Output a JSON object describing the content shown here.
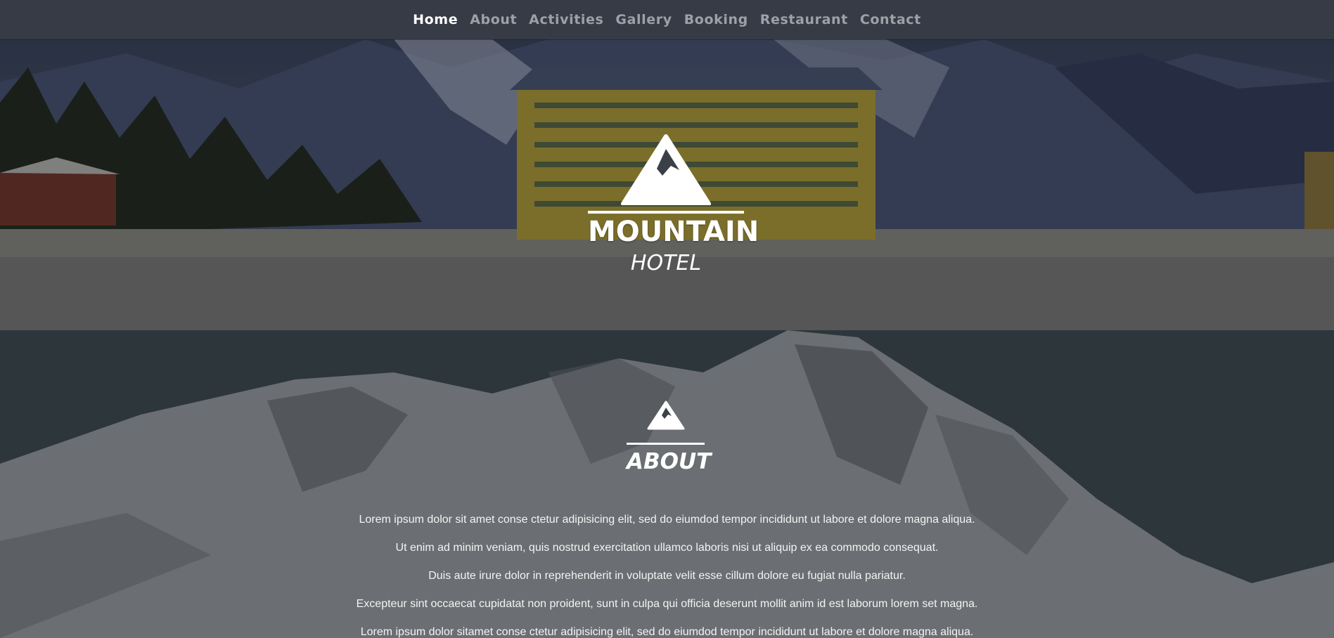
{
  "nav": {
    "items": [
      {
        "label": "Home",
        "active": true
      },
      {
        "label": "About",
        "active": false
      },
      {
        "label": "Activities",
        "active": false
      },
      {
        "label": "Gallery",
        "active": false
      },
      {
        "label": "Booking",
        "active": false
      },
      {
        "label": "Restaurant",
        "active": false
      },
      {
        "label": "Contact",
        "active": false
      }
    ]
  },
  "hero": {
    "logo_icon": "mountain-peak-icon",
    "title": "MOUNTAIN",
    "subtitle": "HOTEL"
  },
  "about": {
    "logo_icon": "mountain-peak-icon",
    "title": "ABOUT",
    "paragraphs": [
      "Lorem ipsum dolor sit amet conse ctetur adipisicing elit, sed do eiumdod tempor incididunt ut labore et dolore magna aliqua.",
      "Ut enim ad minim veniam, quis nostrud exercitation ullamco laboris nisi ut aliquip ex ea commodo consequat.",
      "Duis aute irure dolor in reprehenderit in voluptate velit esse cillum dolore eu fugiat nulla pariatur.",
      "Excepteur sint occaecat cupidatat non proident, sunt in culpa qui officia deserunt mollit anim id est laborum lorem set magna.",
      "Lorem ipsum dolor sitamet conse ctetur adipisicing elit, sed do eiumdod tempor incididunt ut labore et dolore magna aliqua."
    ]
  },
  "colors": {
    "nav_bg": "#373b45",
    "nav_active": "#ffffff",
    "nav_inactive": "#9ea1a8",
    "text": "#ffffff"
  }
}
